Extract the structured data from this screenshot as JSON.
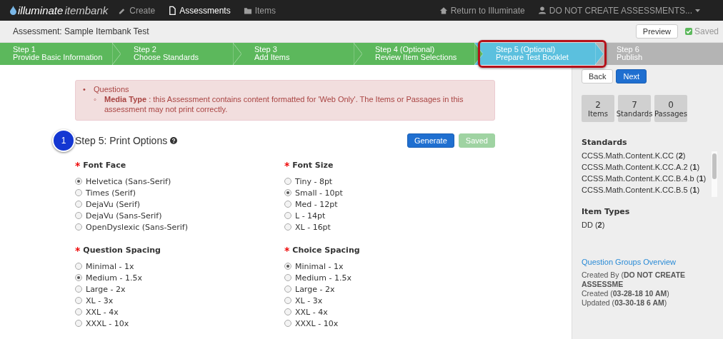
{
  "navbar": {
    "logo": {
      "brand": "illuminate",
      "product": "itembank"
    },
    "links": [
      {
        "label": "Create",
        "kind": "pencil",
        "selected": false
      },
      {
        "label": "Assessments",
        "kind": "document",
        "selected": true
      },
      {
        "label": "Items",
        "kind": "folder",
        "selected": false
      }
    ],
    "return_link": "Return to Illuminate",
    "user_menu": "DO NOT CREATE ASSESSMENTS..."
  },
  "header": {
    "title": "Assessment: Sample Itembank Test",
    "preview_button": "Preview",
    "saved_label": "Saved"
  },
  "steps": [
    {
      "step": "Step 1",
      "title": "Provide Basic Information",
      "kind": "done",
      "highlighted": false
    },
    {
      "step": "Step 2",
      "title": "Choose Standards",
      "kind": "done",
      "highlighted": false
    },
    {
      "step": "Step 3",
      "title": "Add Items",
      "kind": "done",
      "highlighted": false
    },
    {
      "step": "Step 4 (Optional)",
      "title": "Review Item Selections",
      "kind": "done",
      "highlighted": false
    },
    {
      "step": "Step 5 (Optional)",
      "title": "Prepare Test Booklet",
      "kind": "current",
      "highlighted": true
    },
    {
      "step": "Step 6",
      "title": "Publish",
      "kind": "todo",
      "highlighted": false
    }
  ],
  "alert": {
    "bullet": "•",
    "heading": "Questions",
    "items": [
      {
        "bullet": "◦",
        "text": "**Media Type** : this Assessment contains content formatted for 'Web Only'. The Items or Passages in this assessment may not print correctly."
      }
    ]
  },
  "annotation": {
    "number": "1"
  },
  "print_options": {
    "title": "Step 5: Print Options",
    "generate_button": "Generate",
    "saved_button": "Saved",
    "groups": [
      {
        "label": "Font Face",
        "required_mark": "*",
        "options": [
          {
            "label": "Helvetica (Sans-Serif)",
            "selected": true
          },
          {
            "label": "Times (Serif)",
            "selected": false
          },
          {
            "label": "DejaVu (Serif)",
            "selected": false
          },
          {
            "label": "DejaVu (Sans-Serif)",
            "selected": false
          },
          {
            "label": "OpenDyslexic (Sans-Serif)",
            "selected": false
          }
        ]
      },
      {
        "label": "Font Size",
        "required_mark": "*",
        "options": [
          {
            "label": "Tiny - 8pt",
            "selected": false
          },
          {
            "label": "Small - 10pt",
            "selected": true
          },
          {
            "label": "Med - 12pt",
            "selected": false
          },
          {
            "label": "L - 14pt",
            "selected": false
          },
          {
            "label": "XL - 16pt",
            "selected": false
          }
        ]
      },
      {
        "label": "Question Spacing",
        "required_mark": "*",
        "options": [
          {
            "label": "Minimal - 1x",
            "selected": false
          },
          {
            "label": "Medium - 1.5x",
            "selected": true
          },
          {
            "label": "Large - 2x",
            "selected": false
          },
          {
            "label": "XL - 3x",
            "selected": false
          },
          {
            "label": "XXL - 4x",
            "selected": false
          },
          {
            "label": "XXXL - 10x",
            "selected": false
          }
        ]
      },
      {
        "label": "Choice Spacing",
        "required_mark": "*",
        "options": [
          {
            "label": "Minimal - 1x",
            "selected": true
          },
          {
            "label": "Medium - 1.5x",
            "selected": false
          },
          {
            "label": "Large - 2x",
            "selected": false
          },
          {
            "label": "XL - 3x",
            "selected": false
          },
          {
            "label": "XXL - 4x",
            "selected": false
          },
          {
            "label": "XXXL - 10x",
            "selected": false
          }
        ]
      }
    ]
  },
  "sidebar": {
    "back_button": "Back",
    "next_button": "Next",
    "counts": [
      {
        "value": "2",
        "label": "Items"
      },
      {
        "value": "7",
        "label": "Standards"
      },
      {
        "value": "0",
        "label": "Passages"
      }
    ],
    "standards": {
      "title": "Standards",
      "items": [
        "CCSS.Math.Content.K.CC (**2**)",
        "CCSS.Math.Content.K.CC.A.2 (**1**)",
        "CCSS.Math.Content.K.CC.B.4.b (**1**)",
        "CCSS.Math.Content.K.CC.B.5 (**1**)"
      ]
    },
    "item_types": {
      "title": "Item Types",
      "items": [
        "DD (**2**)"
      ]
    },
    "overview_link": "Question Groups Overview",
    "meta": [
      "Created By (**DO NOT CREATE ASSESSME**",
      "Created (**03-28-18 10 AM**)",
      "Updated (**03-30-18 6 AM**)"
    ]
  }
}
